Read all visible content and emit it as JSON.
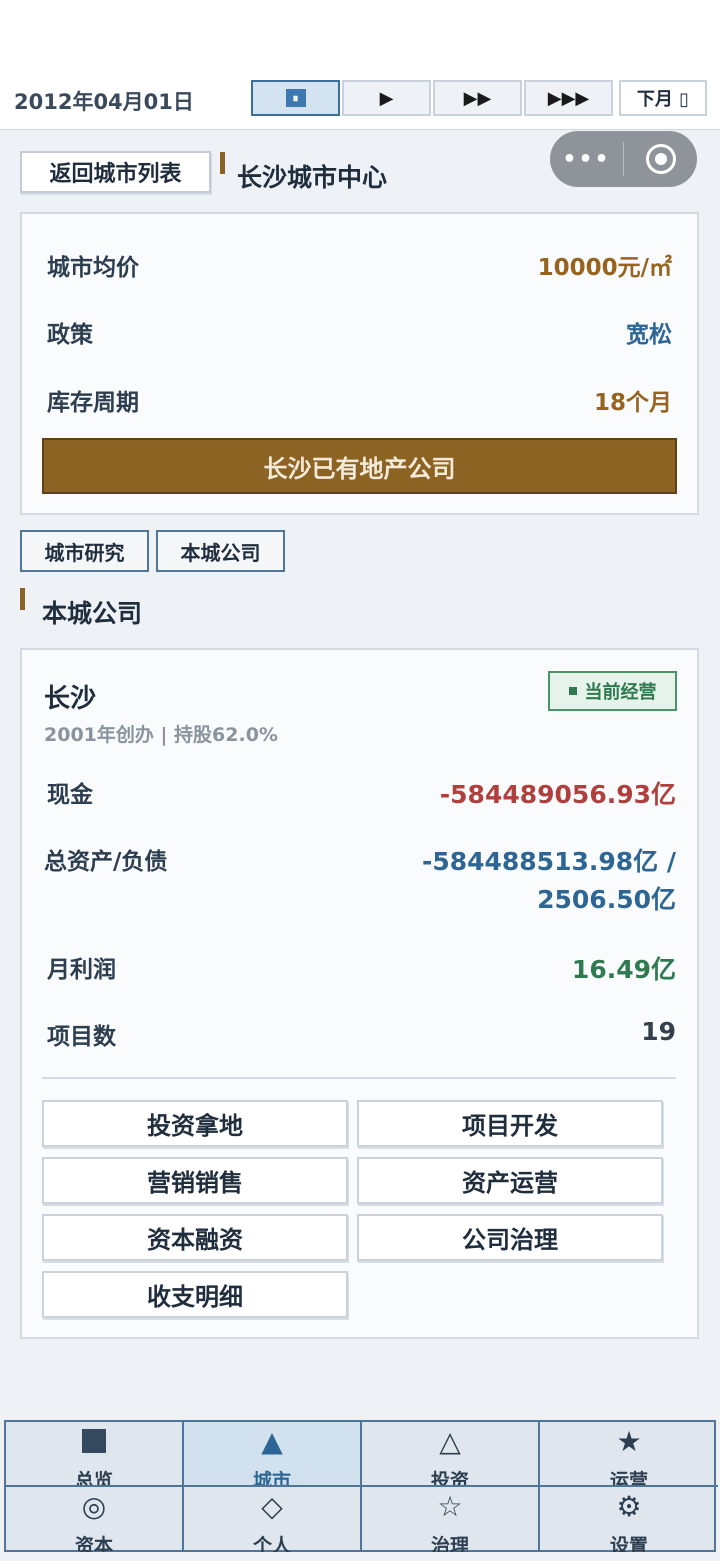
{
  "header": {
    "date": "2012年04月01日",
    "speed_buttons": [
      "⏸",
      "▶",
      "▶▶",
      "▶▶▶"
    ],
    "next_month": "下月 ▯"
  },
  "capsule": {
    "more": "•••"
  },
  "city": {
    "back_label": "返回城市列表",
    "title": "长沙城市中心",
    "stats": [
      {
        "label": "城市均价",
        "value": "10000元/㎡"
      },
      {
        "label": "政策",
        "value": "宽松"
      },
      {
        "label": "库存周期",
        "value": "18个月"
      }
    ],
    "companies_button": "长沙已有地产公司"
  },
  "tabs": [
    "城市研究",
    "本城公司"
  ],
  "section_title": "本城公司",
  "company": {
    "name": "长沙",
    "subtitle": "2001年创办 | 持股62.0%",
    "status": "当前经营",
    "rows": [
      {
        "label": "现金",
        "value": "-584489056.93亿"
      },
      {
        "label": "总资产/负债",
        "value_line1": "-584488513.98亿 /",
        "value_line2": "2506.50亿"
      },
      {
        "label": "月利润",
        "value": "16.49亿"
      },
      {
        "label": "项目数",
        "value": "19"
      }
    ],
    "actions": [
      "投资拿地",
      "项目开发",
      "营销销售",
      "资产运营",
      "资本融资",
      "公司治理",
      "收支明细"
    ]
  },
  "bottom_nav": [
    {
      "label": "总览",
      "icon": "■"
    },
    {
      "label": "城市",
      "icon": "▲"
    },
    {
      "label": "投资",
      "icon": "△"
    },
    {
      "label": "运营",
      "icon": "★"
    },
    {
      "label": "资本",
      "icon": "◎"
    },
    {
      "label": "个人",
      "icon": "◇"
    },
    {
      "label": "治理",
      "icon": "☆"
    },
    {
      "label": "设置",
      "icon": "⚙"
    }
  ],
  "colors": {
    "accent_gold": "#8c6323",
    "value_blue": "#2d6594",
    "value_red": "#b0403e",
    "value_green": "#2f7a50"
  }
}
